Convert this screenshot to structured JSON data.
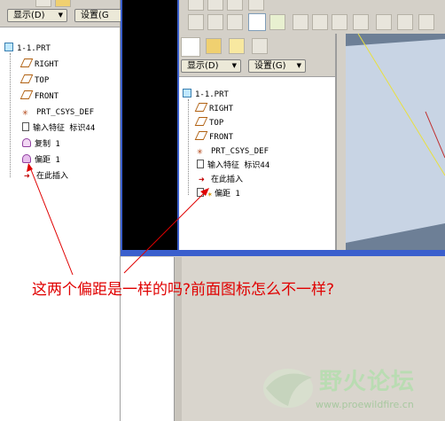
{
  "left_panel": {
    "display_button": "显示(D)",
    "settings_button": "设置(G",
    "tree": [
      {
        "label": "1-1.PRT",
        "icon": "part-icon"
      },
      {
        "label": "RIGHT",
        "icon": "datum-plane-icon"
      },
      {
        "label": "TOP",
        "icon": "datum-plane-icon"
      },
      {
        "label": "FRONT",
        "icon": "datum-plane-icon"
      },
      {
        "label": "PRT_CSYS_DEF",
        "icon": "csys-icon"
      },
      {
        "label": "输入特征 标识44",
        "icon": "import-feature-icon"
      },
      {
        "label": "复制 1",
        "icon": "copy-surface-icon"
      },
      {
        "label": "偏距 1",
        "icon": "offset-surface-icon"
      },
      {
        "label": "在此插入",
        "icon": "insert-here-arrow-icon"
      }
    ]
  },
  "inset_panel": {
    "display_button": "显示(D)",
    "settings_button": "设置(G)",
    "tree": [
      {
        "label": "1-1.PRT",
        "icon": "part-icon"
      },
      {
        "label": "RIGHT",
        "icon": "datum-plane-icon"
      },
      {
        "label": "TOP",
        "icon": "datum-plane-icon"
      },
      {
        "label": "FRONT",
        "icon": "datum-plane-icon"
      },
      {
        "label": "PRT_CSYS_DEF",
        "icon": "csys-icon"
      },
      {
        "label": "输入特征 标识44",
        "icon": "import-feature-icon"
      },
      {
        "label": "在此插入",
        "icon": "insert-here-arrow-icon"
      },
      {
        "label": "偏距 1",
        "icon": "offset-surface-icon"
      }
    ]
  },
  "annotation": {
    "text": "这两个偏距是一样的吗?前面图标怎么不一样?"
  },
  "watermark": {
    "title": "野火论坛",
    "url": "www.proewildfire.cn"
  },
  "colors": {
    "annotation_red": "#e00000",
    "viewport_blue": "#c8d4e4",
    "window_frame": "#3a5fcd"
  }
}
